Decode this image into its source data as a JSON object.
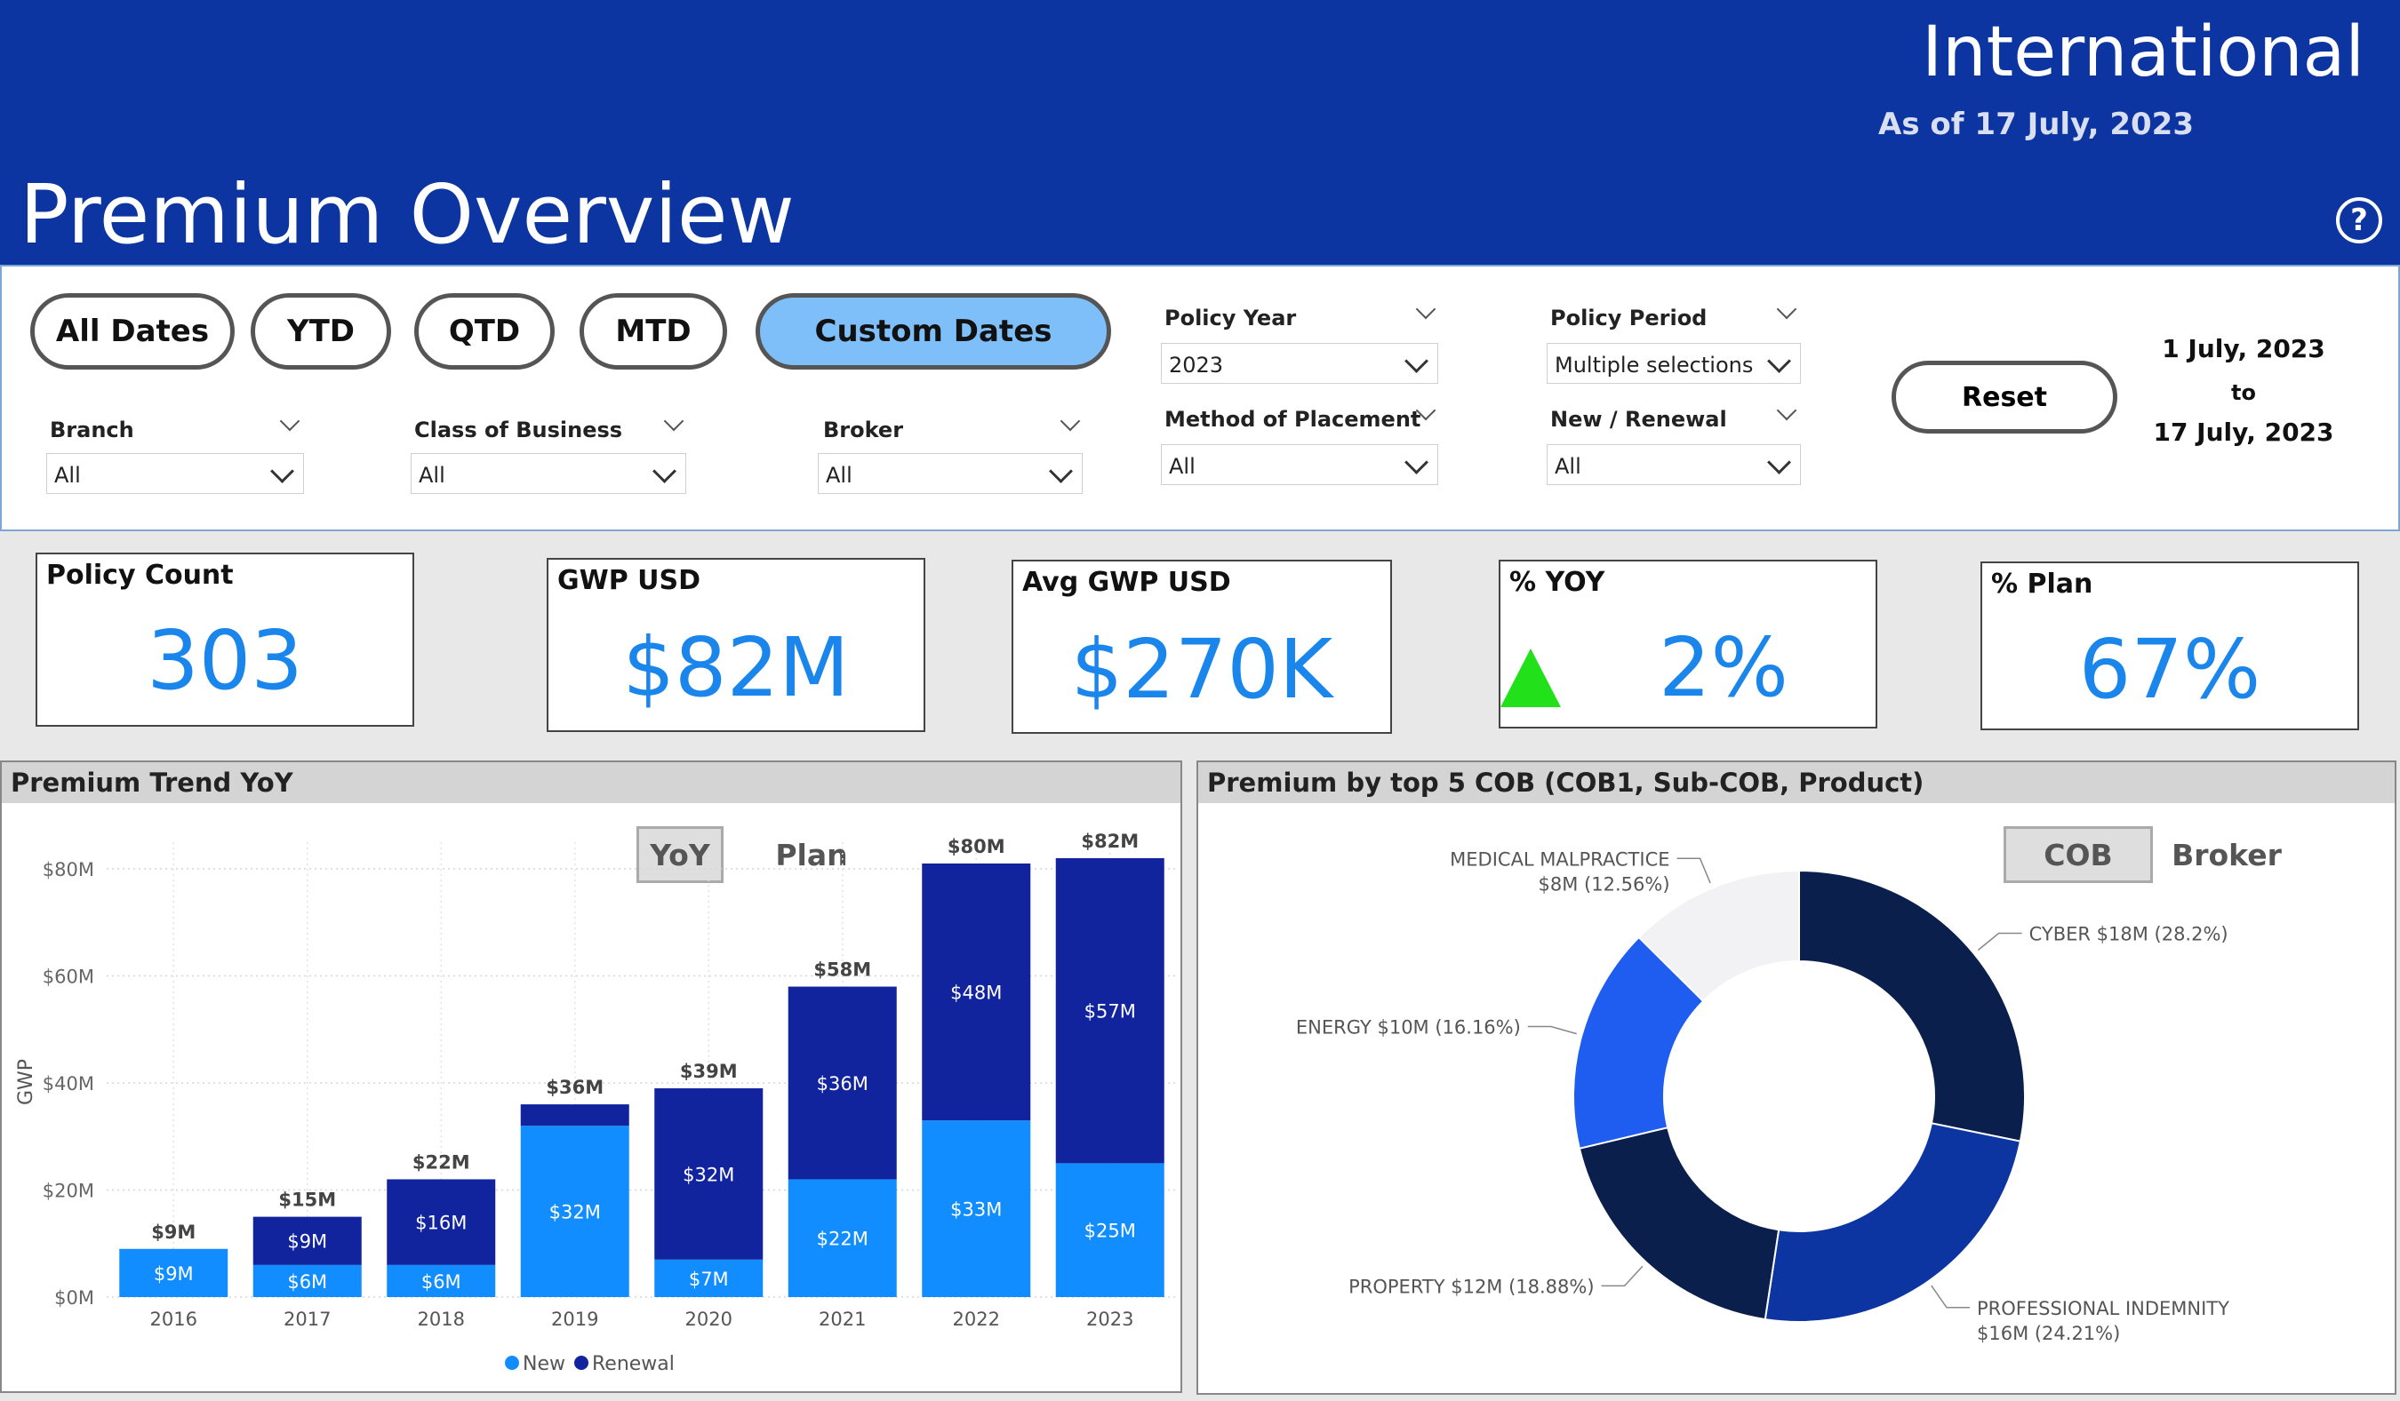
{
  "header": {
    "region": "International",
    "as_of": "As of  17 July, 2023",
    "page_title": "Premium Overview",
    "help_glyph": "?"
  },
  "date_buttons": [
    {
      "label": "All Dates",
      "active": false
    },
    {
      "label": "YTD",
      "active": false
    },
    {
      "label": "QTD",
      "active": false
    },
    {
      "label": "MTD",
      "active": false
    },
    {
      "label": "Custom Dates",
      "active": true
    }
  ],
  "filters": {
    "branch": {
      "label": "Branch",
      "value": "All"
    },
    "class_of_business": {
      "label": "Class of Business",
      "value": "All"
    },
    "broker": {
      "label": "Broker",
      "value": "All"
    },
    "policy_year": {
      "label": "Policy Year",
      "value": "2023"
    },
    "method_of_placement": {
      "label": "Method of Placement",
      "value": "All"
    },
    "policy_period": {
      "label": "Policy Period",
      "value": "Multiple selections"
    },
    "new_renewal": {
      "label": "New / Renewal",
      "value": "All"
    }
  },
  "reset_label": "Reset",
  "date_range": {
    "from": "1 July, 2023",
    "to_word": "to",
    "to": "17 July, 2023"
  },
  "kpis": [
    {
      "title": "Policy Count",
      "value": "303"
    },
    {
      "title": "GWP USD",
      "value": "$82M"
    },
    {
      "title": "Avg GWP USD",
      "value": "$270K"
    },
    {
      "title": "% YOY",
      "value": "2%",
      "trend": "up",
      "trend_color": "#22e01a"
    },
    {
      "title": "% Plan",
      "value": "67%"
    }
  ],
  "trend_panel": {
    "title": "Premium Trend YoY",
    "toggles": [
      {
        "label": "YoY",
        "active": true
      },
      {
        "label": "Plan",
        "active": false
      }
    ]
  },
  "cob_panel": {
    "title": "Premium by top 5 COB (COB1, Sub-COB, Product)",
    "toggles": [
      {
        "label": "COB",
        "active": true
      },
      {
        "label": "Broker",
        "active": false
      }
    ]
  },
  "chart_data": [
    {
      "type": "bar",
      "stacked": true,
      "ylabel": "GWP",
      "ylim": [
        0,
        80
      ],
      "yticks": [
        "$0M",
        "$20M",
        "$40M",
        "$60M",
        "$80M"
      ],
      "categories": [
        "2016",
        "2017",
        "2018",
        "2019",
        "2020",
        "2021",
        "2022",
        "2023"
      ],
      "series": [
        {
          "name": "New",
          "color": "#118dff",
          "values": [
            9,
            6,
            6,
            32,
            7,
            22,
            33,
            25
          ],
          "labels": [
            "$9M",
            "$6M",
            "$6M",
            "$32M",
            "$7M",
            "$22M",
            "$33M",
            "$25M"
          ]
        },
        {
          "name": "Renewal",
          "color": "#12239e",
          "values": [
            0,
            9,
            16,
            4,
            32,
            36,
            48,
            57
          ],
          "labels": [
            "",
            "$9M",
            "$16M",
            "",
            "$32M",
            "$36M",
            "$48M",
            "$57M"
          ]
        }
      ],
      "totals": [
        "$9M",
        "$15M",
        "$22M",
        "$36M",
        "$39M",
        "$58M",
        "$80M",
        "$82M"
      ],
      "legend": "bottom-center"
    },
    {
      "type": "pie",
      "donut": true,
      "slices": [
        {
          "label": "CYBER $18M (28.2%)",
          "value": 28.2,
          "color": "#0b1f4d"
        },
        {
          "label": "PROFESSIONAL INDEMNITY",
          "label2": "$16M (24.21%)",
          "value": 24.21,
          "color": "#0c35a2"
        },
        {
          "label": "PROPERTY $12M (18.88%)",
          "value": 18.88,
          "color": "#0b1f4d"
        },
        {
          "label": "ENERGY $10M (16.16%)",
          "value": 16.16,
          "color": "#1f5cf0"
        },
        {
          "label": "MEDICAL MALPRACTICE",
          "label2": "$8M (12.56%)",
          "value": 12.56,
          "color": "#f2f2f4"
        }
      ]
    }
  ]
}
